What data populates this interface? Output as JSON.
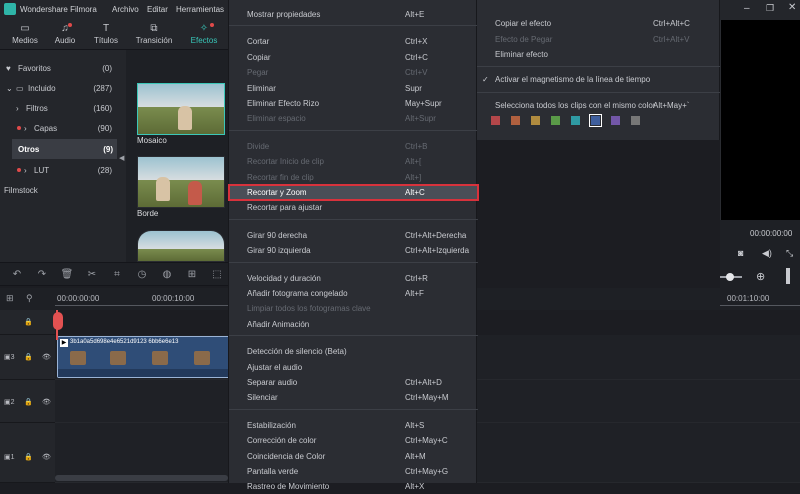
{
  "app": {
    "title": "Wondershare Filmora",
    "menu": [
      "Archivo",
      "Editar",
      "Herramientas"
    ]
  },
  "tabs": [
    {
      "label": "Medios",
      "icon": "folder-icon"
    },
    {
      "label": "Audio",
      "icon": "music-note-icon"
    },
    {
      "label": "Títulos",
      "icon": "text-icon"
    },
    {
      "label": "Transición",
      "icon": "transition-icon"
    },
    {
      "label": "Efectos",
      "icon": "effects-icon"
    }
  ],
  "sidebar": {
    "items": [
      {
        "label": "Favoritos",
        "count": "(0)"
      },
      {
        "label": "Incluido",
        "count": "(287)"
      },
      {
        "label": "Filtros",
        "count": "(160)"
      },
      {
        "label": "Capas",
        "count": "(90)"
      },
      {
        "label": "Otros",
        "count": "(9)"
      },
      {
        "label": "LUT",
        "count": "(28)"
      },
      {
        "label": "Filmstock",
        "count": ""
      }
    ]
  },
  "effects": {
    "items": [
      {
        "name": "Mosaico"
      },
      {
        "name": "Borde"
      }
    ]
  },
  "timeline": {
    "ruler": [
      "00:00:00:00",
      "00:00:10:00",
      "00:01:10:00"
    ],
    "clip_name": "3b1a0a5d698e4e6521d9123 6bb6e6e13",
    "preview_time": "00:00:00:00"
  },
  "menu1": {
    "groups": [
      [
        {
          "label": "Mostrar propiedades",
          "shortcut": "Alt+E",
          "disabled": false
        }
      ],
      [
        {
          "label": "Cortar",
          "shortcut": "Ctrl+X",
          "disabled": false
        },
        {
          "label": "Copiar",
          "shortcut": "Ctrl+C",
          "disabled": false
        },
        {
          "label": "Pegar",
          "shortcut": "Ctrl+V",
          "disabled": true
        },
        {
          "label": "Eliminar",
          "shortcut": "Supr",
          "disabled": false
        },
        {
          "label": "Eliminar Efecto Rizo",
          "shortcut": "May+Supr",
          "disabled": false
        },
        {
          "label": "Eliminar espacio",
          "shortcut": "Alt+Supr",
          "disabled": true
        }
      ],
      [
        {
          "label": "Divide",
          "shortcut": "Ctrl+B",
          "disabled": true
        },
        {
          "label": "Recortar Inicio de clip",
          "shortcut": "Alt+[",
          "disabled": true
        },
        {
          "label": "Recortar fin de clip",
          "shortcut": "Alt+]",
          "disabled": true
        },
        {
          "label": "Recortar y Zoom",
          "shortcut": "Alt+C",
          "disabled": false,
          "highlight": true
        },
        {
          "label": "Recortar para ajustar",
          "shortcut": "",
          "disabled": false
        }
      ],
      [
        {
          "label": "Girar 90 derecha",
          "shortcut": "Ctrl+Alt+Derecha",
          "disabled": false
        },
        {
          "label": "Girar 90 izquierda",
          "shortcut": "Ctrl+Alt+Izquierda",
          "disabled": false
        }
      ],
      [
        {
          "label": "Velocidad y duración",
          "shortcut": "Ctrl+R",
          "disabled": false
        },
        {
          "label": "Añadir fotograma congelado",
          "shortcut": "Alt+F",
          "disabled": false
        },
        {
          "label": "Limpiar todos los fotogramas clave",
          "shortcut": "",
          "disabled": true
        },
        {
          "label": "Añadir Animación",
          "shortcut": "",
          "disabled": false
        }
      ],
      [
        {
          "label": "Detección de silencio (Beta)",
          "shortcut": "",
          "disabled": false
        },
        {
          "label": "Ajustar el audio",
          "shortcut": "",
          "disabled": false
        },
        {
          "label": "Separar audio",
          "shortcut": "Ctrl+Alt+D",
          "disabled": false
        },
        {
          "label": "Silenciar",
          "shortcut": "Ctrl+May+M",
          "disabled": false
        }
      ],
      [
        {
          "label": "Estabilización",
          "shortcut": "Alt+S",
          "disabled": false
        },
        {
          "label": "Corrección de color",
          "shortcut": "Ctrl+May+C",
          "disabled": false
        },
        {
          "label": "Coincidencia de Color",
          "shortcut": "Alt+M",
          "disabled": false
        },
        {
          "label": "Pantalla verde",
          "shortcut": "Ctrl+May+G",
          "disabled": false
        },
        {
          "label": "Rastreo de Movimiento",
          "shortcut": "Alt+X",
          "disabled": false
        }
      ]
    ]
  },
  "menu2": {
    "items": [
      {
        "label": "Copiar el efecto",
        "shortcut": "Ctrl+Alt+C",
        "disabled": false
      },
      {
        "label": "Efecto de Pegar",
        "shortcut": "Ctrl+Alt+V",
        "disabled": true
      },
      {
        "label": "Eliminar efecto",
        "shortcut": "",
        "disabled": false
      }
    ],
    "snap_label": "Activar el magnetismo de la línea de tiempo",
    "select_label": "Selecciona todos los clips con el mismo color",
    "select_shortcut": "Alt+May+`",
    "swatches": [
      "#b4474a",
      "#b0603f",
      "#b08b3f",
      "#5a9a48",
      "#2f9aa3",
      "#3f5f9e",
      "#7357a8",
      "#777777"
    ]
  },
  "colors": {
    "accent": "#38c7b9",
    "highlight_outline": "#d8323c",
    "menu_bg": "#2b2d33"
  }
}
